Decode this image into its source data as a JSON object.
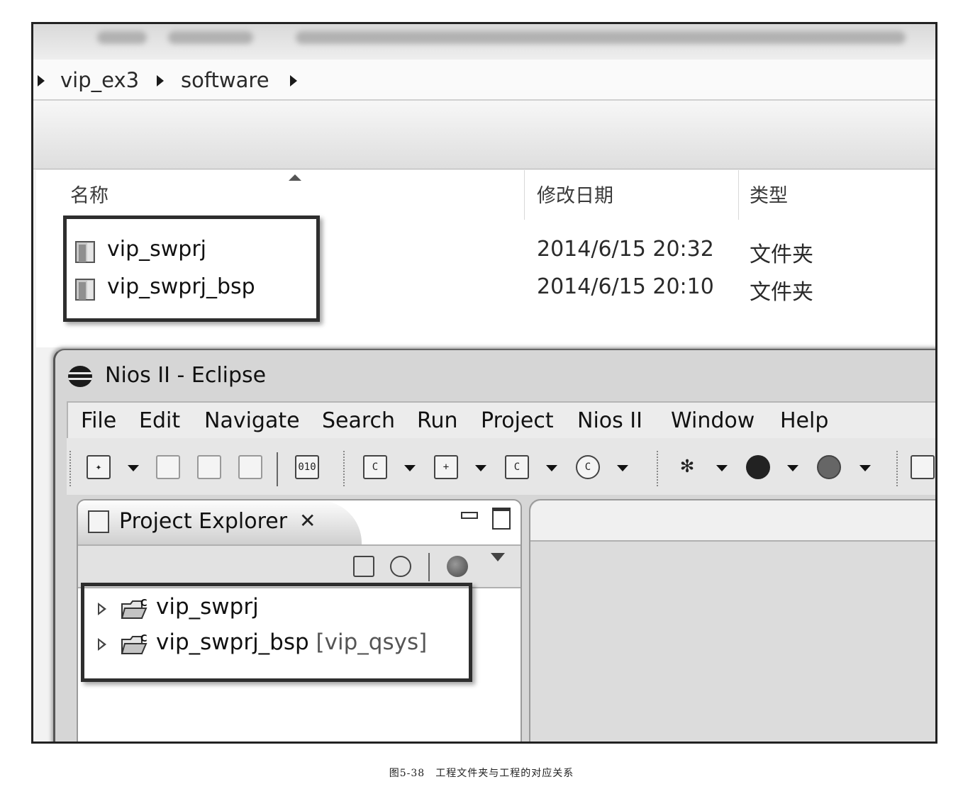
{
  "breadcrumb": {
    "items": [
      "vip_ex3",
      "software"
    ]
  },
  "file_list": {
    "columns": [
      "名称",
      "修改日期",
      "类型"
    ],
    "rows": [
      {
        "name": "vip_swprj",
        "date": "2014/6/15 20:32",
        "type": "文件夹"
      },
      {
        "name": "vip_swprj_bsp",
        "date": "2014/6/15 20:10",
        "type": "文件夹"
      }
    ]
  },
  "eclipse": {
    "title": "Nios II - Eclipse",
    "menu": [
      "File",
      "Edit",
      "Navigate",
      "Search",
      "Run",
      "Project",
      "Nios II",
      "Window",
      "Help"
    ],
    "project_explorer": {
      "tab_label": "Project Explorer",
      "projects": [
        {
          "name": "vip_swprj",
          "extra": ""
        },
        {
          "name": "vip_swprj_bsp",
          "extra": "[vip_qsys]"
        }
      ]
    }
  },
  "caption": "图5-38　工程文件夹与工程的对应关系",
  "icons": [
    "folder-icon",
    "eclipse-logo-icon",
    "new-icon",
    "save-icon",
    "save-all-icon",
    "print-icon",
    "binary-icon",
    "new-c-project-icon",
    "new-c-file-icon",
    "debug-icon",
    "run-icon",
    "external-tools-icon",
    "collapse-all-icon",
    "link-with-editor-icon",
    "view-menu-icon"
  ]
}
